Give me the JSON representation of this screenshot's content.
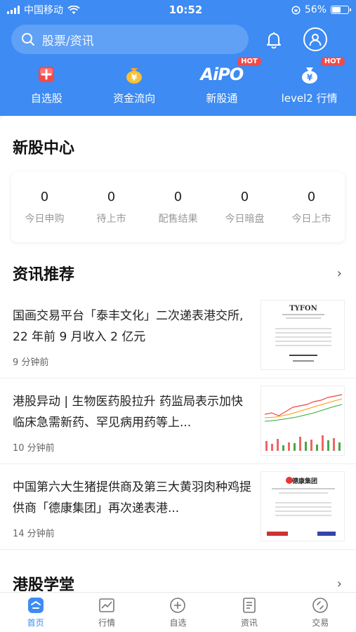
{
  "status_bar": {
    "carrier": "中国移动",
    "time": "10:52",
    "battery": "56%"
  },
  "search": {
    "placeholder": "股票/资讯"
  },
  "quick_nav": [
    {
      "label": "自选股",
      "icon": "plus-badge-icon"
    },
    {
      "label": "资金流向",
      "icon": "money-bag-icon"
    },
    {
      "label": "新股通",
      "icon": "aipo-logo",
      "logo_text": "AiPO",
      "badge": "HOT"
    },
    {
      "label": "level2 行情",
      "icon": "yuan-bag-icon",
      "badge": "HOT"
    }
  ],
  "ipo_center": {
    "title": "新股中心",
    "stats": [
      {
        "value": "0",
        "label": "今日申购"
      },
      {
        "value": "0",
        "label": "待上市"
      },
      {
        "value": "0",
        "label": "配售结果"
      },
      {
        "value": "0",
        "label": "今日暗盘"
      },
      {
        "value": "0",
        "label": "今日上市"
      }
    ]
  },
  "news": {
    "title": "资讯推荐",
    "items": [
      {
        "title": "国画交易平台「泰丰文化」二次递表港交所, 22 年前 9 月收入 2 亿元",
        "time": "9 分钟前",
        "thumb_text": "TYFON"
      },
      {
        "title": "港股异动 | 生物医药股拉升 药监局表示加快临床急需新药、罕见病用药等上...",
        "time": "10 分钟前"
      },
      {
        "title": "中国第六大生猪提供商及第三大黄羽肉种鸡提供商「德康集团」再次递表港...",
        "time": "14 分钟前",
        "thumb_text": "德康集团"
      }
    ]
  },
  "hk_school": {
    "title": "港股学堂"
  },
  "tab_bar": [
    {
      "label": "首页",
      "icon": "home-icon",
      "active": true
    },
    {
      "label": "行情",
      "icon": "chart-icon"
    },
    {
      "label": "自选",
      "icon": "add-circle-icon"
    },
    {
      "label": "资讯",
      "icon": "news-icon"
    },
    {
      "label": "交易",
      "icon": "trade-icon"
    }
  ],
  "colors": {
    "brand": "#3d8bf3",
    "hot_badge": "#f24a4a"
  }
}
